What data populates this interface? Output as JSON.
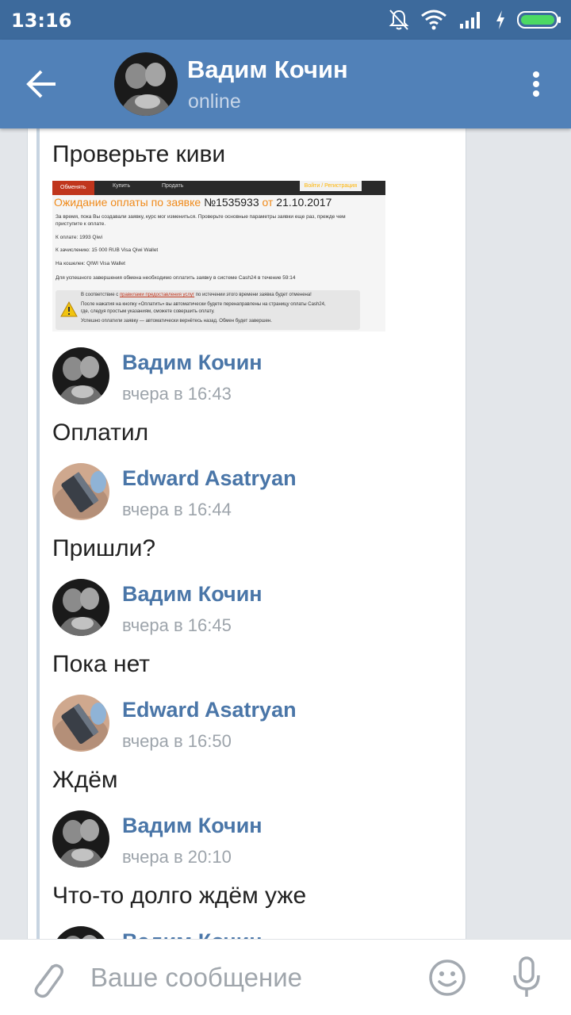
{
  "status_bar": {
    "time": "13:16",
    "icons": [
      "bell-muted-icon",
      "wifi-icon",
      "signal-icon",
      "charging-icon",
      "battery-icon"
    ]
  },
  "header": {
    "name": "Вадим Кочин",
    "status": "online"
  },
  "attachment": {
    "tabs": [
      "Обменять",
      "Купить",
      "Продать"
    ],
    "login_link": "Войти / Регистрация",
    "title_prefix": "Ожидание оплаты по заявке ",
    "order_number": "№1535933",
    "title_mid": " от ",
    "order_date": "21.10.2017",
    "line_rate": "За время, пока Вы создавали заявку, курс мог измениться. Проверьте основные параметры заявки еще раз, прежде чем",
    "line_rate2": "приступите к оплате.",
    "line_pay": "К оплате: 1993 Qiwi",
    "line_receive": "К зачислению: 15 000 RUB  Visa Qiwi Wallet",
    "line_wallet": "На кошелек: QIWI Visa Wallet",
    "line_timer": "Для успешного завершения обмена необходимо оплатить заявку в системе Cash24 в течение 59:14",
    "notice_1a": "В соответствие с ",
    "notice_1_link": "правилами предоставления услуг",
    "notice_1b": " по истечении этого времени заявка будет отменена!",
    "notice_2": "После нажатия на кнопку «Оплатить» вы автоматически будете перенаправлены на страницу оплаты Cash24,",
    "notice_3": "где, следуя простым указаниям, сможете совершить оплату.",
    "notice_4": "Успешно оплатили заявку — автоматически вернётесь назад. Обмен будет завершен."
  },
  "messages": [
    {
      "text": "Проверьте киви"
    },
    {
      "sender": "Вадим Кочин",
      "time": "вчера в 16:43",
      "text": "Оплатил"
    },
    {
      "sender": "Edward Asatryan",
      "time": "вчера в 16:44",
      "text": "Пришли?"
    },
    {
      "sender": "Вадим Кочин",
      "time": "вчера в 16:45",
      "text": "Пока нет"
    },
    {
      "sender": "Edward Asatryan",
      "time": "вчера в 16:50",
      "text": "Ждём"
    },
    {
      "sender": "Вадим Кочин",
      "time": "вчера в 20:10",
      "text": "Что-то долго ждём уже"
    },
    {
      "sender": "Вадим Кочин"
    }
  ],
  "composer": {
    "placeholder": "Ваше сообщение"
  }
}
